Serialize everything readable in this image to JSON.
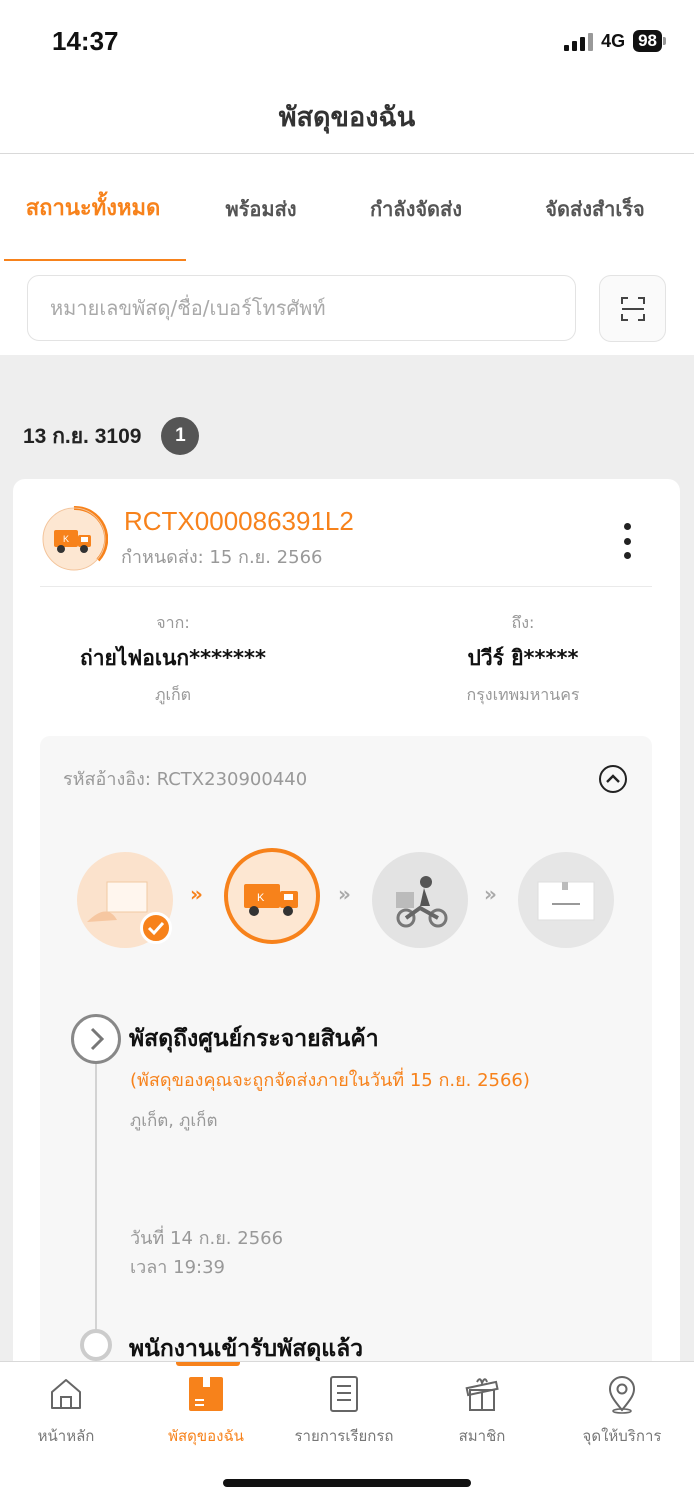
{
  "status_bar": {
    "time": "14:37",
    "network": "4G",
    "battery": "98"
  },
  "header": {
    "title": "พัสดุของฉัน"
  },
  "tabs": [
    {
      "label": "สถานะทั้งหมด"
    },
    {
      "label": "พร้อมส่ง"
    },
    {
      "label": "กำลังจัดส่ง"
    },
    {
      "label": "จัดส่งสำเร็จ"
    }
  ],
  "search": {
    "placeholder": "หมายเลขพัสดุ/ชื่อ/เบอร์โทรศัพท์"
  },
  "group": {
    "date": "13 ก.ย. 3109",
    "count": "1"
  },
  "parcel": {
    "tracking_no": "RCTX000086391L2",
    "due_date": "กำหนดส่ง: 15 ก.ย. 2566",
    "from": {
      "caption": "จาก:",
      "name": "ถ่ายไฟอเนก*******",
      "city": "ภูเก็ต"
    },
    "to": {
      "caption": "ถึง:",
      "name": "ปวีร์ ยิ*****",
      "city": "กรุงเทพมหานคร"
    },
    "reference": "รหัสอ้างอิง: RCTX230900440",
    "step_arrow": "»",
    "timeline": [
      {
        "title": "พัสดุถึงศูนย์กระจายสินค้า",
        "note": "(พัสดุของคุณจะถูกจัดส่งภายในวันที่ 15 ก.ย. 2566)",
        "location": "ภูเก็ต, ภูเก็ต",
        "date": "วันที่ 14 ก.ย. 2566",
        "time": "เวลา 19:39"
      },
      {
        "title": "พนักงานเข้ารับพัสดุแล้ว"
      }
    ]
  },
  "bottom_nav": [
    {
      "label": "หน้าหลัก",
      "icon": "home-icon"
    },
    {
      "label": "พัสดุของฉัน",
      "icon": "parcel-icon"
    },
    {
      "label": "รายการเรียกรถ",
      "icon": "list-icon"
    },
    {
      "label": "สมาชิก",
      "icon": "gift-icon"
    },
    {
      "label": "จุดให้บริการ",
      "icon": "location-icon"
    }
  ],
  "colors": {
    "accent": "#f7821b",
    "background": "#eeeeee"
  }
}
